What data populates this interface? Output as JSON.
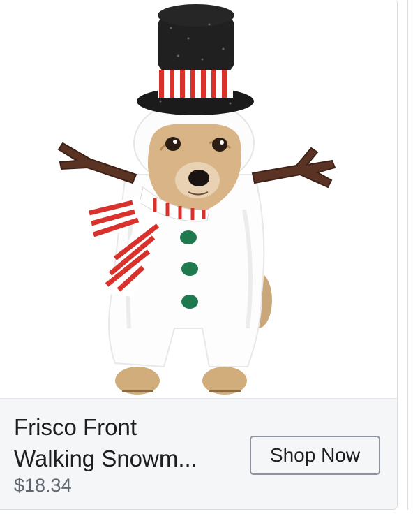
{
  "product": {
    "image_alt": "dog wearing snowman costume",
    "title_line1": "Frisco Front",
    "title_line2": "Walking Snowm...",
    "price": "$18.34",
    "cta_label": "Shop Now"
  },
  "colors": {
    "info_background": "#f5f6f7",
    "title_text": "#1c1e21",
    "price_text": "#606770",
    "button_border": "#8d949e"
  }
}
